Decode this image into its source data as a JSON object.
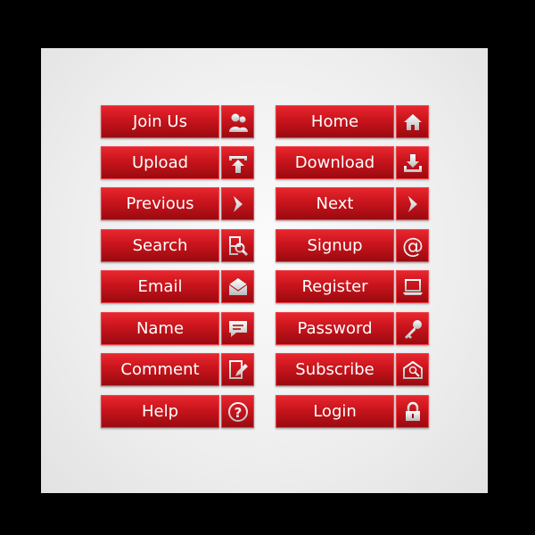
{
  "buttons": [
    {
      "label": "Join Us",
      "icon": "users-icon"
    },
    {
      "label": "Home",
      "icon": "home-icon"
    },
    {
      "label": "Upload",
      "icon": "upload-icon"
    },
    {
      "label": "Download",
      "icon": "download-icon"
    },
    {
      "label": "Previous",
      "icon": "chevron-icon"
    },
    {
      "label": "Next",
      "icon": "chevron-icon"
    },
    {
      "label": "Search",
      "icon": "search-document-icon"
    },
    {
      "label": "Signup",
      "icon": "at-icon"
    },
    {
      "label": "Email",
      "icon": "envelope-icon"
    },
    {
      "label": "Register",
      "icon": "laptop-icon"
    },
    {
      "label": "Name",
      "icon": "speech-bubble-icon"
    },
    {
      "label": "Password",
      "icon": "key-icon"
    },
    {
      "label": "Comment",
      "icon": "edit-document-icon"
    },
    {
      "label": "Subscribe",
      "icon": "mail-search-icon"
    },
    {
      "label": "Help",
      "icon": "question-icon"
    },
    {
      "label": "Login",
      "icon": "lock-icon"
    }
  ],
  "colors": {
    "button_red": "#c8141c",
    "icon_silver": "#e0e0e0"
  }
}
